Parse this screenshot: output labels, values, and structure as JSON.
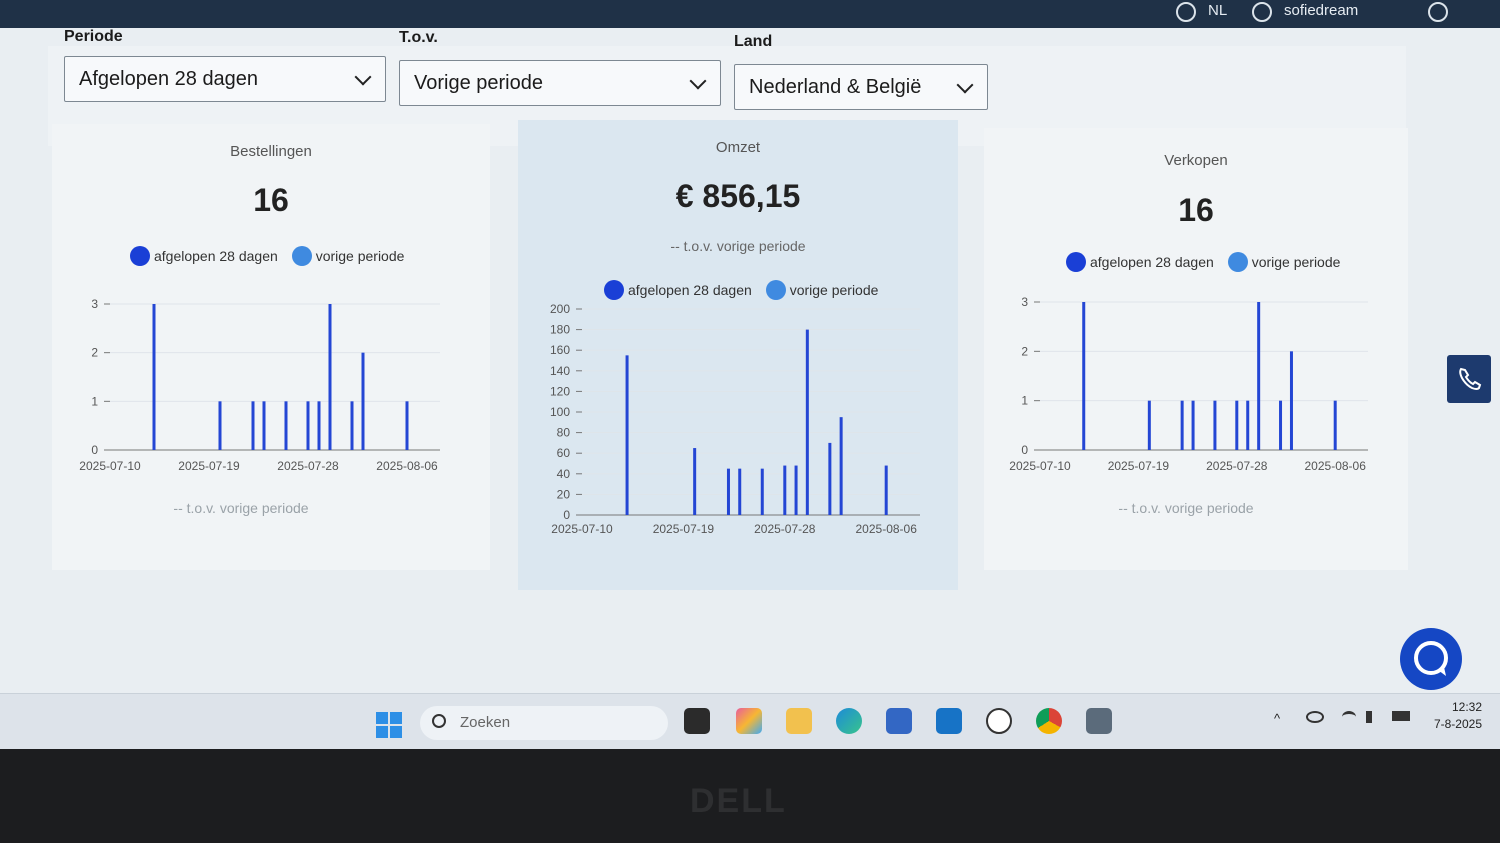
{
  "topbar": {
    "lang": "NL",
    "user": "sofiedream"
  },
  "filters": {
    "periode": {
      "label": "Periode",
      "value": "Afgelopen 28 dagen"
    },
    "tov": {
      "label": "T.o.v.",
      "value": "Vorige periode"
    },
    "land": {
      "label": "Land",
      "value": "Nederland & België"
    }
  },
  "cards": {
    "bestellingen": {
      "title": "Bestellingen",
      "value": "16",
      "comparison": "-- t.o.v. vorige periode"
    },
    "omzet": {
      "title": "Omzet",
      "value": "€ 856,15",
      "comparison": "-- t.o.v. vorige periode"
    },
    "verkopen": {
      "title": "Verkopen",
      "value": "16",
      "comparison": "-- t.o.v. vorige periode"
    }
  },
  "legend": {
    "current": "afgelopen 28 dagen",
    "previous": "vorige periode"
  },
  "colors": {
    "current": "#1a3fd6",
    "previous": "#3f8ae0",
    "bar": "#2446d4"
  },
  "chart_data": [
    {
      "type": "bar",
      "title": "Bestellingen",
      "x_ticks": [
        "2025-07-10",
        "2025-07-19",
        "2025-07-28",
        "2025-08-06"
      ],
      "y_ticks": [
        0,
        1,
        2,
        3
      ],
      "ylim": [
        0,
        3
      ],
      "xlim": [
        0,
        30
      ],
      "grid": true,
      "legend_position": "top",
      "series": [
        {
          "name": "afgelopen 28 dagen",
          "points": [
            [
              4,
              3
            ],
            [
              10,
              1
            ],
            [
              13,
              1
            ],
            [
              14,
              1
            ],
            [
              16,
              1
            ],
            [
              18,
              1
            ],
            [
              19,
              1
            ],
            [
              20,
              3
            ],
            [
              22,
              1
            ],
            [
              23,
              2
            ],
            [
              27,
              1
            ]
          ]
        }
      ]
    },
    {
      "type": "bar",
      "title": "Omzet",
      "x_ticks": [
        "2025-07-10",
        "2025-07-19",
        "2025-07-28",
        "2025-08-06"
      ],
      "y_ticks": [
        0,
        20,
        40,
        60,
        80,
        100,
        120,
        140,
        160,
        180,
        200
      ],
      "ylim": [
        0,
        200
      ],
      "xlim": [
        0,
        30
      ],
      "grid": true,
      "legend_position": "top",
      "series": [
        {
          "name": "afgelopen 28 dagen",
          "points": [
            [
              4,
              155
            ],
            [
              10,
              65
            ],
            [
              13,
              45
            ],
            [
              14,
              45
            ],
            [
              16,
              45
            ],
            [
              18,
              48
            ],
            [
              19,
              48
            ],
            [
              20,
              180
            ],
            [
              22,
              70
            ],
            [
              23,
              95
            ],
            [
              27,
              48
            ]
          ]
        }
      ]
    },
    {
      "type": "bar",
      "title": "Verkopen",
      "x_ticks": [
        "2025-07-10",
        "2025-07-19",
        "2025-07-28",
        "2025-08-06"
      ],
      "y_ticks": [
        0,
        1,
        2,
        3
      ],
      "ylim": [
        0,
        3
      ],
      "xlim": [
        0,
        30
      ],
      "grid": true,
      "legend_position": "top",
      "series": [
        {
          "name": "afgelopen 28 dagen",
          "points": [
            [
              4,
              3
            ],
            [
              10,
              1
            ],
            [
              13,
              1
            ],
            [
              14,
              1
            ],
            [
              16,
              1
            ],
            [
              18,
              1
            ],
            [
              19,
              1
            ],
            [
              20,
              3
            ],
            [
              22,
              1
            ],
            [
              23,
              2
            ],
            [
              27,
              1
            ]
          ]
        }
      ]
    }
  ],
  "taskbar": {
    "search_placeholder": "Zoeken",
    "time": "12:32",
    "date": "7-8-2025"
  },
  "bezel": {
    "logo": "DELL"
  }
}
